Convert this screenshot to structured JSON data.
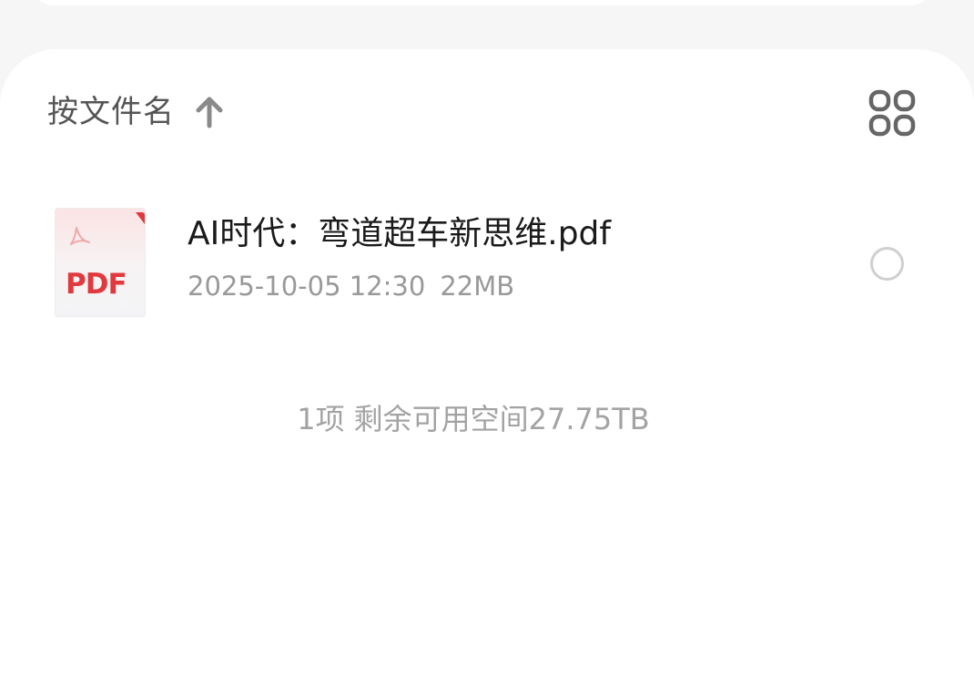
{
  "sort": {
    "label": "按文件名",
    "direction_icon": "arrow-up-icon"
  },
  "view_toggle": {
    "icon": "grid-view-icon"
  },
  "files": [
    {
      "name": "AI时代：弯道超车新思维.pdf",
      "date": "2025-10-05 12:30",
      "size": "22MB",
      "type_label": "PDF",
      "icon": "pdf-file-icon",
      "selected": false
    }
  ],
  "footer": {
    "count": "1项",
    "space": "剩余可用空间27.75TB"
  },
  "colors": {
    "pdf_red": "#e0393e",
    "text_primary": "#1a1a1a",
    "text_secondary": "#999999",
    "icon_gray": "#666666"
  }
}
